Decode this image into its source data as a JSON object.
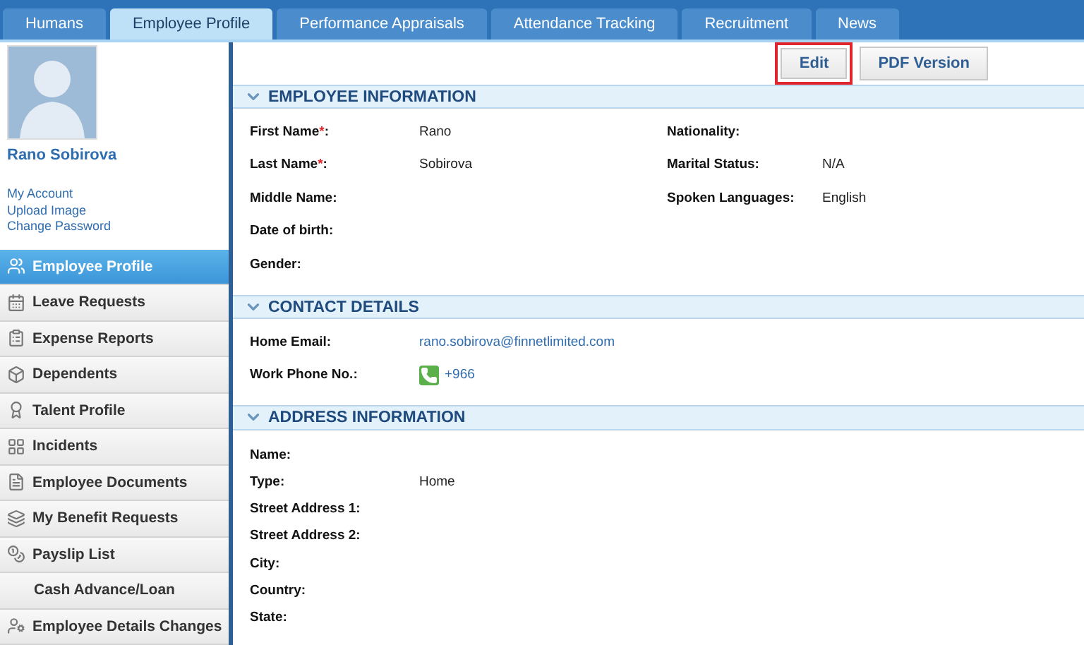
{
  "tabs": [
    {
      "label": "Humans",
      "selected": false
    },
    {
      "label": "Employee Profile",
      "selected": true
    },
    {
      "label": "Performance Appraisals",
      "selected": false
    },
    {
      "label": "Attendance Tracking",
      "selected": false
    },
    {
      "label": "Recruitment",
      "selected": false
    },
    {
      "label": "News",
      "selected": false
    }
  ],
  "profile": {
    "name": "Rano Sobirova",
    "links": [
      "My Account",
      "Upload Image",
      "Change Password"
    ]
  },
  "menu": [
    {
      "label": "Employee Profile",
      "selected": true,
      "kind": "icon"
    },
    {
      "label": "Leave Requests",
      "selected": false,
      "kind": "icon"
    },
    {
      "label": "Expense Reports",
      "selected": false,
      "kind": "icon"
    },
    {
      "label": "Dependents",
      "selected": false,
      "kind": "icon"
    },
    {
      "label": "Talent Profile",
      "selected": false,
      "kind": "icon"
    },
    {
      "label": "Incidents",
      "selected": false,
      "kind": "icon"
    },
    {
      "label": "Employee Documents",
      "selected": false,
      "kind": "icon"
    },
    {
      "label": "My Benefit Requests",
      "selected": false,
      "kind": "icon"
    },
    {
      "label": "Payslip List",
      "selected": false,
      "kind": "icon"
    },
    {
      "label": "Cash Advance/Loan",
      "selected": false,
      "kind": "text"
    },
    {
      "label": "Employee Details Changes",
      "selected": false,
      "kind": "icon"
    }
  ],
  "buttons": [
    {
      "label": "Edit",
      "highlighted": true
    },
    {
      "label": "PDF Version",
      "highlighted": false
    }
  ],
  "sections": [
    {
      "title": "EMPLOYEE INFORMATION",
      "left": [
        {
          "label": "First Name",
          "required_mark": "*",
          "label_end": ":",
          "value": "Rano",
          "kind": "text"
        },
        {
          "label": "Last Name",
          "required_mark": "*",
          "label_end": ":",
          "value": "Sobirova",
          "kind": "text"
        },
        {
          "label": "Middle Name:"
        },
        {
          "label": "Date of birth:"
        },
        {
          "label": "Gender:"
        }
      ],
      "right": [
        {
          "label": "Nationality:"
        },
        {
          "label": "Marital Status:",
          "value": "N/A",
          "kind": "text"
        },
        {
          "label": "Spoken Languages:",
          "value": "English",
          "kind": "text"
        }
      ]
    },
    {
      "title": "CONTACT DETAILS",
      "left": [
        {
          "label": "Home Email:",
          "value": "rano.sobirova@finnetlimited.com",
          "kind": "link"
        },
        {
          "label": "Work Phone No.:",
          "value": "+966",
          "kind": "phone"
        }
      ]
    },
    {
      "title": "ADDRESS INFORMATION",
      "left": [
        {
          "label": "Name:"
        },
        {
          "label": "Type:",
          "value": "Home",
          "kind": "text"
        },
        {
          "label": "Street Address 1:"
        },
        {
          "label": "Street Address 2:"
        },
        {
          "label": "City:"
        },
        {
          "label": "Country:"
        },
        {
          "label": "State:"
        }
      ]
    }
  ]
}
